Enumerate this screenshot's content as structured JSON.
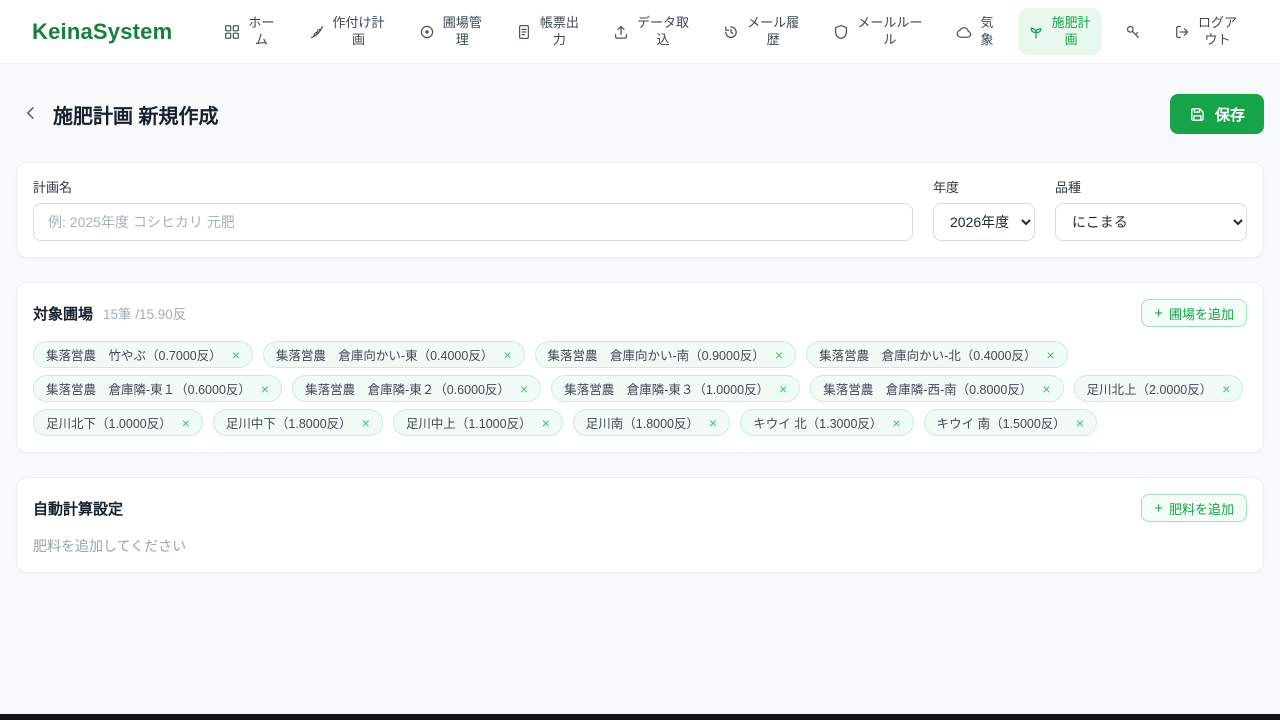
{
  "brand": {
    "name": "KeinaSystem"
  },
  "icons": {
    "plus": "+",
    "close": "×"
  },
  "nav": {
    "active": "施肥計画",
    "items": [
      {
        "label": "ホーム",
        "icon": "grid"
      },
      {
        "label": "作付け計画",
        "icon": "wheat"
      },
      {
        "label": "圃場管理",
        "icon": "map-pin"
      },
      {
        "label": "帳票出力",
        "icon": "document"
      },
      {
        "label": "データ取込",
        "icon": "upload"
      },
      {
        "label": "メール履歴",
        "icon": "history"
      },
      {
        "label": "メールルール",
        "icon": "shield"
      },
      {
        "label": "気象",
        "icon": "cloud"
      },
      {
        "label": "施肥計画",
        "icon": "seedling"
      },
      {
        "label": "",
        "icon": "key"
      },
      {
        "label": "ログアウト",
        "icon": "logout"
      }
    ]
  },
  "header": {
    "title": "施肥計画 新規作成",
    "save_button": "保存"
  },
  "plan_form": {
    "name_label": "計画名",
    "name_placeholder": "例: 2025年度 コシヒカリ 元肥",
    "name_value": "",
    "year_label": "年度",
    "year_value": "2026年度",
    "variety_label": "品種",
    "variety_value": "にこまる"
  },
  "fields_section": {
    "title": "対象圃場",
    "summary": "15筆 /15.90反",
    "add_button": "圃場を追加",
    "chips": [
      "集落営農　竹やぶ（0.7000反）",
      "集落営農　倉庫向かい-東（0.4000反）",
      "集落営農　倉庫向かい-南（0.9000反）",
      "集落営農　倉庫向かい-北（0.4000反）",
      "集落営農　倉庫隣-東１（0.6000反）",
      "集落営農　倉庫隣-東２（0.6000反）",
      "集落営農　倉庫隣-東３（1.0000反）",
      "集落営農　倉庫隣-西-南（0.8000反）",
      "足川北上（2.0000反）",
      "足川北下（1.0000反）",
      "足川中下（1.8000反）",
      "足川中上（1.1000反）",
      "足川南（1.8000反）",
      "キウイ 北（1.3000反）",
      "キウイ 南（1.5000反）"
    ]
  },
  "fertilizer_section": {
    "title": "自動計算設定",
    "add_button": "肥料を追加",
    "empty_text": "肥料を追加してください"
  },
  "colors": {
    "brand_green": "#15803d",
    "accent_green": "#16a34a",
    "active_nav_bg": "#e9f8ef",
    "chip_bg": "#f1fbf5",
    "chip_border": "#c9eed8",
    "page_bg": "#f7f9fb"
  }
}
